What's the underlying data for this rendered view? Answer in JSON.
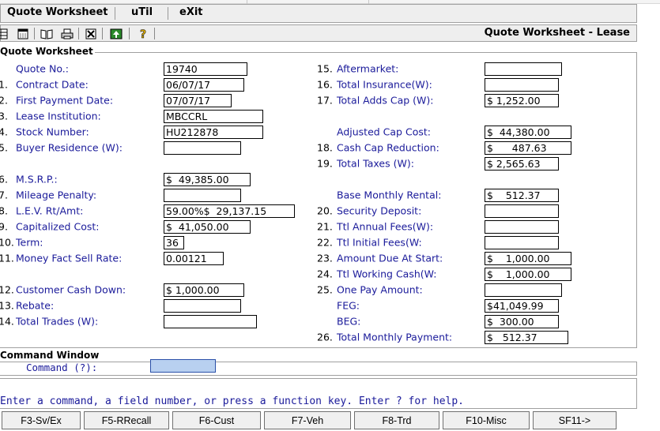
{
  "menu": {
    "items": [
      "Quote Worksheet",
      "uTil",
      "eXit"
    ]
  },
  "toolbar": {
    "title": "Quote Worksheet - Lease"
  },
  "panel": {
    "title": "Quote Worksheet"
  },
  "left_fields": [
    {
      "num": "",
      "label": "Quote No.:",
      "value": "19740"
    },
    {
      "num": "1.",
      "label": "Contract Date:",
      "value": "06/07/17"
    },
    {
      "num": "2.",
      "label": "First Payment Date:",
      "value": "07/07/17"
    },
    {
      "num": "3.",
      "label": "Lease Institution:",
      "value": "MBCCRL"
    },
    {
      "num": "4.",
      "label": "Stock Number:",
      "value": "HU212878"
    },
    {
      "num": "5.",
      "label": "Buyer Residence (W):",
      "value": ""
    },
    {
      "num": "6.",
      "label": "M.S.R.P.:",
      "value": "$  49,385.00"
    },
    {
      "num": "7.",
      "label": "Mileage Penalty:",
      "value": ""
    },
    {
      "num": "8.",
      "label": "L.E.V. Rt/Amt:",
      "value": "59.00%$  29,137.15"
    },
    {
      "num": "9.",
      "label": "Capitalized Cost:",
      "value": "$  41,050.00"
    },
    {
      "num": "10.",
      "label": "Term:",
      "value": "36"
    },
    {
      "num": "11.",
      "label": "Money Fact Sell Rate:",
      "value": "0.00121"
    },
    {
      "num": "12.",
      "label": "Customer Cash Down:",
      "value": "$ 1,000.00"
    },
    {
      "num": "13.",
      "label": "Rebate:",
      "value": ""
    },
    {
      "num": "14.",
      "label": "Total Trades (W):",
      "value": ""
    }
  ],
  "right_fields": [
    {
      "num": "15.",
      "label": "Aftermarket:",
      "value": ""
    },
    {
      "num": "16.",
      "label": "Total Insurance(W):",
      "value": ""
    },
    {
      "num": "17.",
      "label": "Total Adds Cap (W):",
      "value": "$ 1,252.00"
    },
    {
      "num": "",
      "label": "Adjusted Cap Cost:",
      "value": "$  44,380.00"
    },
    {
      "num": "18.",
      "label": "Cash Cap Reduction:",
      "value": "$      487.63"
    },
    {
      "num": "19.",
      "label": "Total Taxes (W):",
      "value": "$ 2,565.63"
    },
    {
      "num": "",
      "label": "Base Monthly Rental:",
      "value": "$    512.37"
    },
    {
      "num": "20.",
      "label": "Security Deposit:",
      "value": ""
    },
    {
      "num": "21.",
      "label": "Ttl Annual Fees(W):",
      "value": ""
    },
    {
      "num": "22.",
      "label": "Ttl Initial Fees(W:",
      "value": ""
    },
    {
      "num": "23.",
      "label": "Amount Due At Start:",
      "value": "$    1,000.00"
    },
    {
      "num": "24.",
      "label": "Ttl Working Cash(W:",
      "value": "$    1,000.00"
    },
    {
      "num": "25.",
      "label": "One Pay Amount:",
      "value": ""
    },
    {
      "num": "",
      "label": "FEG:",
      "value": "$41,049.99"
    },
    {
      "num": "",
      "label": "BEG:",
      "value": "$  300.00"
    },
    {
      "num": "26.",
      "label": "Total Monthly Payment:",
      "value": "$   512.37"
    }
  ],
  "command": {
    "title": "Command Window",
    "label": "Command (?):",
    "value": ""
  },
  "message": "Enter a command, a field number, or press a function key. Enter ? for help.",
  "fkeys": [
    "F3-Sv/Ex",
    "F5-RRecall",
    "F6-Cust",
    "F7-Veh",
    "F8-Trd",
    "F10-Misc",
    "SF11->"
  ]
}
